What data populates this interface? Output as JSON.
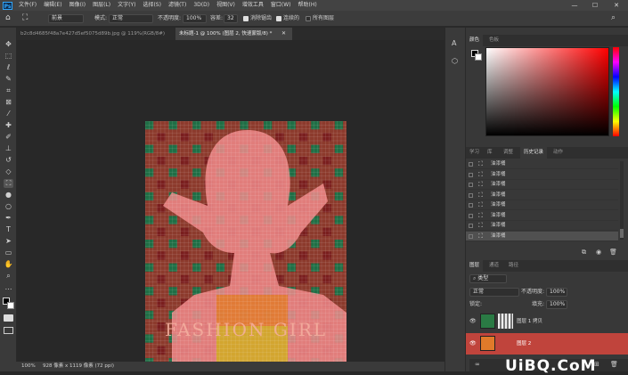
{
  "app": {
    "logo": "Ps"
  },
  "menu": [
    "文件(F)",
    "编辑(E)",
    "图像(I)",
    "图层(L)",
    "文字(Y)",
    "选择(S)",
    "滤镜(T)",
    "3D(D)",
    "视图(V)",
    "增效工具",
    "窗口(W)",
    "帮助(H)"
  ],
  "window_controls": {
    "minimize": "—",
    "maximize": "☐",
    "close": "✕"
  },
  "options": {
    "brush_target": "前景",
    "mode_label": "模式:",
    "mode_value": "正常",
    "opacity_label": "不透明度:",
    "opacity_value": "100%",
    "tolerance_label": "容差:",
    "tolerance_value": "32",
    "anti_alias_label": "消除锯齿",
    "contiguous_label": "连续的",
    "all_layers_label": "所有图层"
  },
  "doc_tabs": [
    {
      "label": "b2c8d4685f48a7e427d5ef5075d89b.jpg @ 119%(RGB/8#)",
      "active": false
    },
    {
      "label": "未标题-1 @ 100% (图层 2, 快速蒙版/8) *",
      "active": true
    }
  ],
  "canvas_text": "FASHION GIRL",
  "status": {
    "zoom": "100%",
    "size": "928 像素 x 1119 像素 (72 ppi)"
  },
  "color_panel": {
    "tabs": [
      "颜色",
      "色板"
    ]
  },
  "history_panel": {
    "tabs": [
      "学习",
      "库",
      "调整",
      "历史记录",
      "动作"
    ],
    "items": [
      "油漆桶",
      "油漆桶",
      "油漆桶",
      "油漆桶",
      "油漆桶",
      "油漆桶",
      "油漆桶",
      "油漆桶"
    ]
  },
  "layers_panel": {
    "tabs": [
      "图层",
      "通道",
      "路径"
    ],
    "filter_kind": "类型",
    "blend_mode": "正常",
    "opacity_label": "不透明度:",
    "opacity_value": "100%",
    "lock_label": "锁定:",
    "fill_label": "填充:",
    "fill_value": "100%",
    "layers": [
      {
        "name": "图层 1 拷贝"
      },
      {
        "name": "图层 2"
      }
    ]
  },
  "watermark": "UiBQ.CoM",
  "colors": {
    "accent": "#31a8ff",
    "art_bg": "#8c3a2c",
    "check_green": "#1f6e45",
    "check_red": "#7a1e1e",
    "figure_pink": "#f08a8a",
    "layer_highlight": "#c0443c"
  }
}
